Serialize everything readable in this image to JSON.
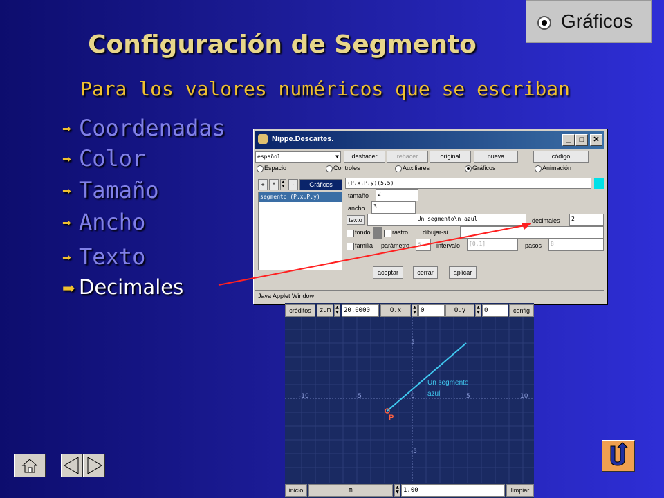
{
  "slide": {
    "title": "Configuración de Segmento",
    "subtitle": "Para los valores numéricos que se escriban",
    "bullets": [
      "Coordenadas",
      "Color",
      "Tamaño",
      "Ancho",
      "Texto",
      "Decimales"
    ],
    "active_bullet": "Decimales",
    "corner_tab": {
      "label": "Gráficos",
      "icon": "radio-selected-icon"
    }
  },
  "applet_window": {
    "title": "Nippe.Descartes.",
    "language_select": "español",
    "toolbar": [
      "deshacer",
      "rehacer",
      "original",
      "nueva",
      "código"
    ],
    "radios": [
      "Espacio",
      "Controles",
      "Auxiliares",
      "Gráficos",
      "Animación"
    ],
    "selected_radio": "Gráficos",
    "list_buttons": [
      "+",
      "*",
      "-"
    ],
    "list_tab": "Gráficos",
    "list_item": "segmento (P.x,P.y)",
    "expression": "(P.x,P.y)(5,5)",
    "tamano_label": "tamaño",
    "tamano_value": "2",
    "ancho_label": "ancho",
    "ancho_value": "3",
    "texto_button": "texto",
    "texto_value": "Un segmento\\n    azul",
    "decimales_label": "decimales",
    "decimales_value": "2",
    "fondo_label": "fondo",
    "rastro_label": "rastro",
    "dibujar_si_label": "dibujar-si",
    "familia_label": "familia",
    "parametro_label": "parámetro",
    "parametro_value": "s",
    "intervalo_label": "intervalo",
    "intervalo_value": "[0,1]",
    "pasos_label": "pasos",
    "pasos_value": "8",
    "actions": [
      "aceptar",
      "cerrar",
      "aplicar"
    ],
    "status": "Java Applet Window"
  },
  "graph": {
    "top_bar": {
      "creditos": "créditos",
      "zoom_label": "zum",
      "zoom_value": "20.0000",
      "ox_label": "O.x",
      "ox_value": "0",
      "oy_label": "O.y",
      "oy_value": "0",
      "config": "config"
    },
    "bottom_bar": {
      "inicio": "inicio",
      "m_label": "m",
      "m_value": "1.00",
      "limpiar": "limpiar"
    },
    "x_ticks": [
      "-10",
      "-5",
      "0",
      "5",
      "10"
    ],
    "y_ticks": [
      "5",
      "-5"
    ],
    "segment_label_line1": "Un segmento",
    "segment_label_line2": "azul",
    "point_label": "P",
    "segment_color": "#40c8f0"
  },
  "nav": {
    "home": "home-icon",
    "prev": "prev-triangle-icon",
    "next": "next-triangle-icon",
    "return": "return-arrow-icon"
  }
}
